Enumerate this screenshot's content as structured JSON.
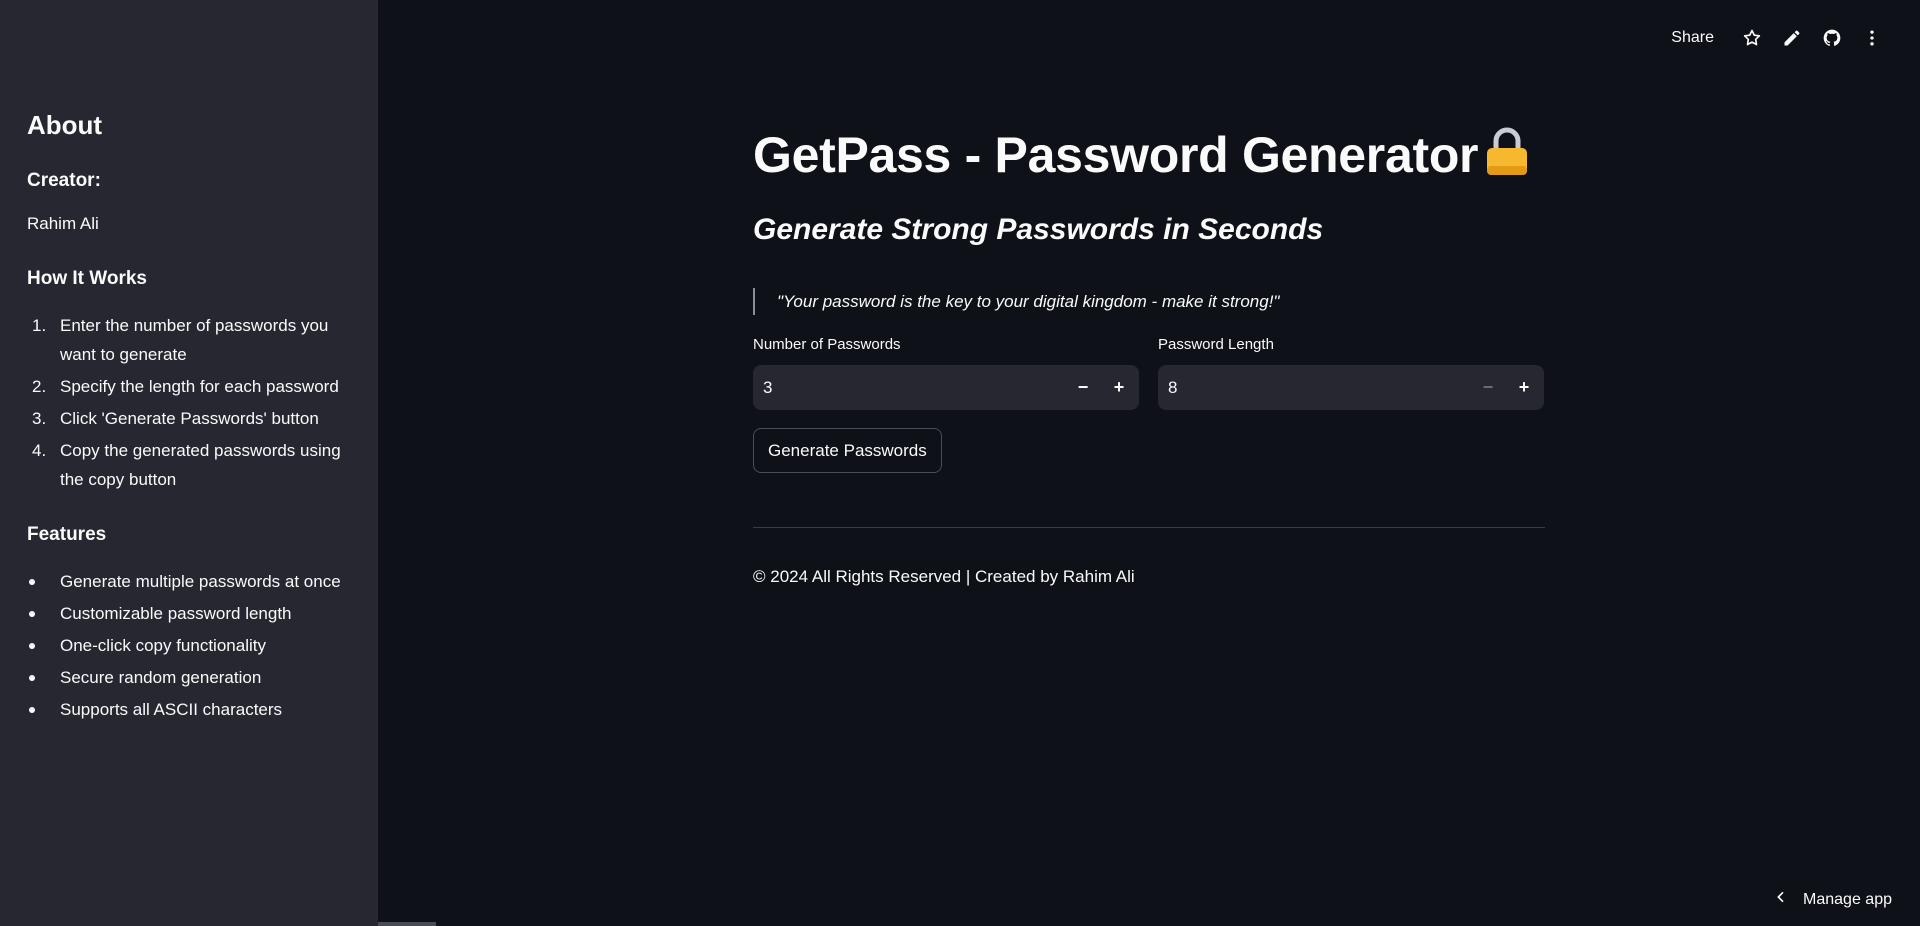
{
  "sidebar": {
    "about_heading": "About",
    "creator_heading": "Creator:",
    "creator_name": "Rahim Ali",
    "how_heading": "How It Works",
    "how_steps": [
      {
        "num": "1.",
        "text": "Enter the number of passwords you want to generate"
      },
      {
        "num": "2.",
        "text": "Specify the length for each password"
      },
      {
        "num": "3.",
        "text": "Click 'Generate Passwords' button"
      },
      {
        "num": "4.",
        "text": "Copy the generated passwords using the copy button"
      }
    ],
    "features_heading": "Features",
    "features": [
      "Generate multiple passwords at once",
      "Customizable password length",
      "One-click copy functionality",
      "Secure random generation",
      "Supports all ASCII characters"
    ]
  },
  "toolbar": {
    "share_label": "Share",
    "icons": [
      "star-icon",
      "pencil-icon",
      "github-icon",
      "more-vertical-icon"
    ]
  },
  "main": {
    "title": "GetPass - Password Generator",
    "title_icon": "lock-icon",
    "subtitle": "Generate Strong Passwords in Seconds",
    "quote": "\"Your password is the key to your digital kingdom - make it strong!\"",
    "num_passwords": {
      "label": "Number of Passwords",
      "value": "3",
      "minus": "−",
      "plus": "+"
    },
    "password_length": {
      "label": "Password Length",
      "value": "8",
      "minus": "−",
      "plus": "+"
    },
    "generate_button": "Generate Passwords",
    "footer": "© 2024 All Rights Reserved | Created by Rahim Ali"
  },
  "manage_app": {
    "label": "Manage app",
    "icon": "chevron-left-icon"
  },
  "colors": {
    "background": "#0e1117",
    "sidebar": "#262730",
    "input_bg": "#262730",
    "text": "#fafafa",
    "lock_body": "#f5b82e"
  }
}
